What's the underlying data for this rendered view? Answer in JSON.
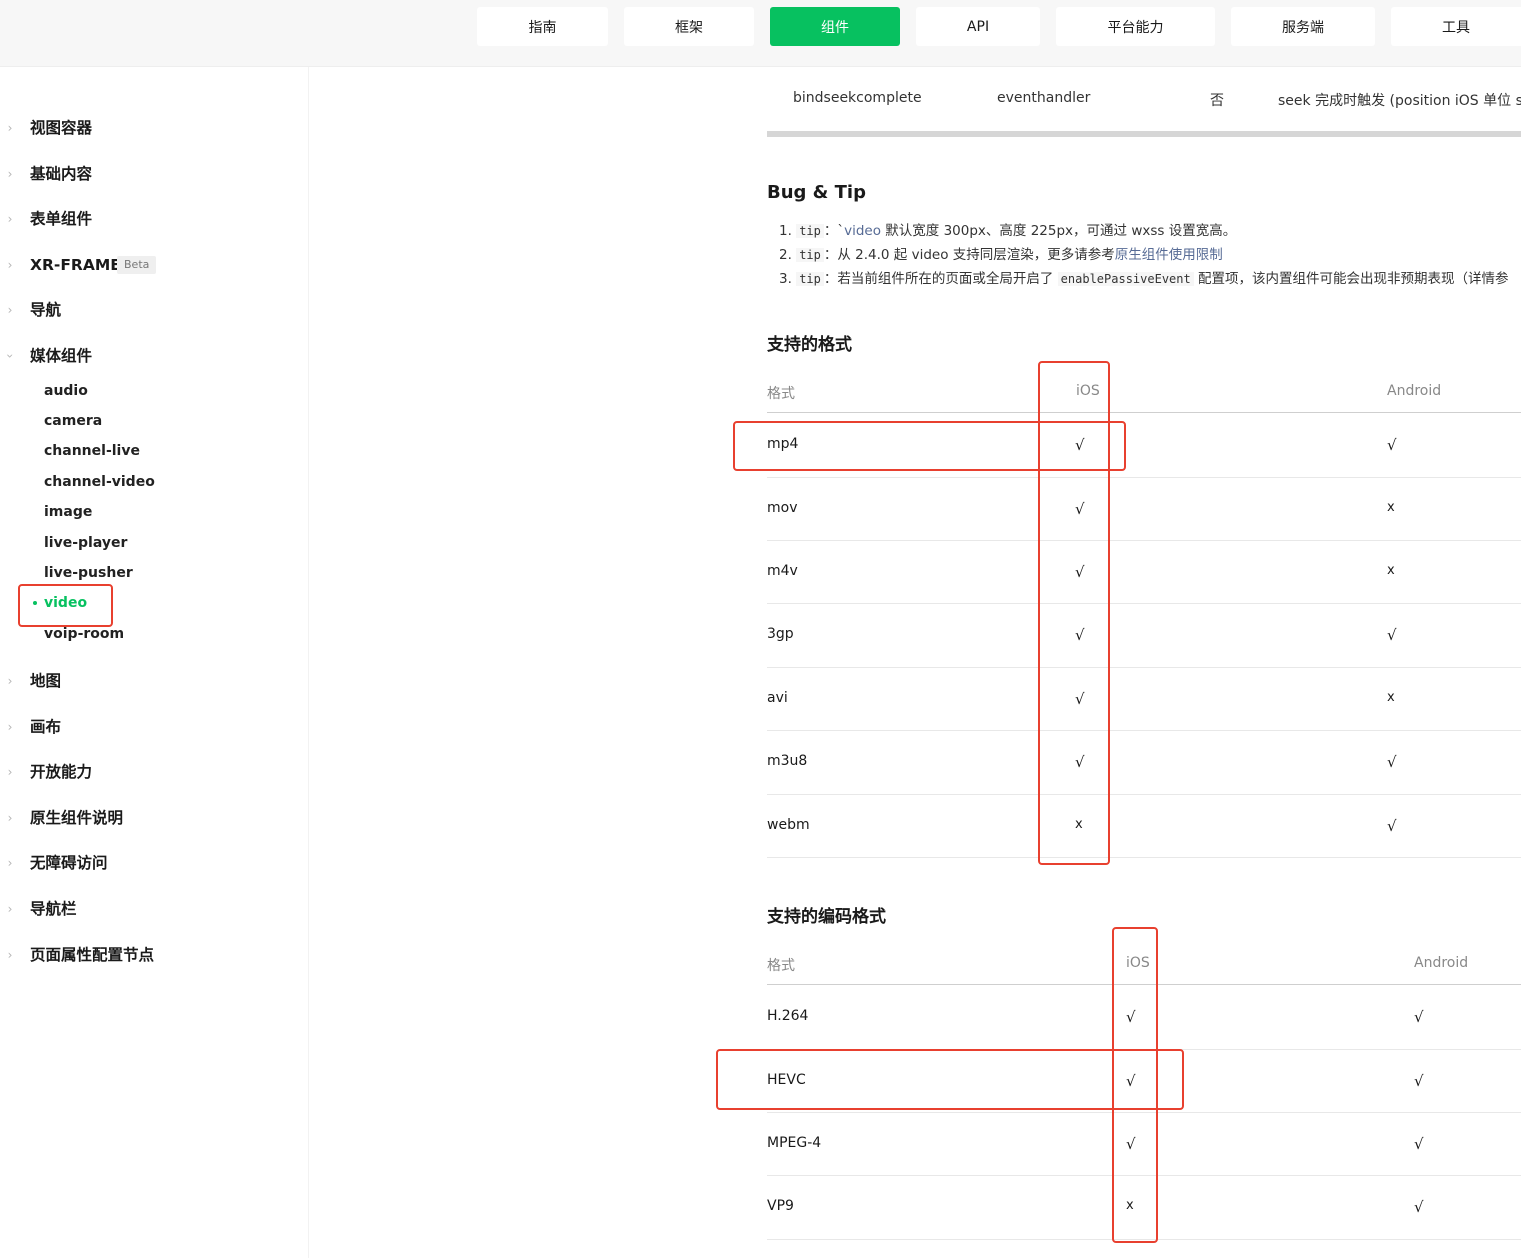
{
  "top_nav": [
    "指南",
    "框架",
    "组件",
    "API",
    "平台能力",
    "服务端",
    "工具"
  ],
  "sidebar": {
    "groups_top": [
      "视图容器",
      "基础内容",
      "表单组件",
      "XR-FRAME"
    ],
    "beta_badge": "Beta",
    "nav_group": "导航",
    "media_group": "媒体组件",
    "media_items": [
      "audio",
      "camera",
      "channel-live",
      "channel-video",
      "image",
      "live-player",
      "live-pusher",
      "video",
      "voip-room"
    ],
    "groups_bottom": [
      "地图",
      "画布",
      "开放能力",
      "原生组件说明",
      "无障碍访问",
      "导航栏",
      "页面属性配置节点"
    ]
  },
  "attr_row": {
    "name": "bindseekcomplete",
    "type": "eventhandler",
    "required": "否",
    "desc": "seek 完成时触发 (position iOS 单位 s, A"
  },
  "bug_tip": {
    "title": "Bug & Tip",
    "tips": [
      {
        "num": "1.",
        "code": "tip",
        "sep": "：",
        "pre": "`",
        "link": "video",
        "post": " 默认宽度 300px、高度 225px，可通过 wxss 设置宽高。"
      },
      {
        "num": "2.",
        "code": "tip",
        "sep": "：",
        "text": "从 2.4.0 起 video 支持同层渲染，更多请参考",
        "link": "原生组件使用限制"
      },
      {
        "num": "3.",
        "code": "tip",
        "sep": "：",
        "text": "若当前组件所在的页面或全局开启了",
        "code2": "enablePassiveEvent",
        "post": "配置项，该内置组件可能会出现非预期表现（详情参"
      }
    ]
  },
  "formats": {
    "title": "支持的格式",
    "headers": [
      "格式",
      "iOS",
      "Android"
    ],
    "rows": [
      [
        "mp4",
        "√",
        "√"
      ],
      [
        "mov",
        "√",
        "x"
      ],
      [
        "m4v",
        "√",
        "x"
      ],
      [
        "3gp",
        "√",
        "√"
      ],
      [
        "avi",
        "√",
        "x"
      ],
      [
        "m3u8",
        "√",
        "√"
      ],
      [
        "webm",
        "x",
        "√"
      ]
    ]
  },
  "codecs": {
    "title": "支持的编码格式",
    "headers": [
      "格式",
      "iOS",
      "Android"
    ],
    "rows": [
      [
        "H.264",
        "√",
        "√"
      ],
      [
        "HEVC",
        "√",
        "√"
      ],
      [
        "MPEG-4",
        "√",
        "√"
      ],
      [
        "VP9",
        "x",
        "√"
      ]
    ]
  },
  "colors": {
    "brand_green": "#07c160",
    "annotation_red": "#e8402f",
    "link": "#576b95"
  }
}
